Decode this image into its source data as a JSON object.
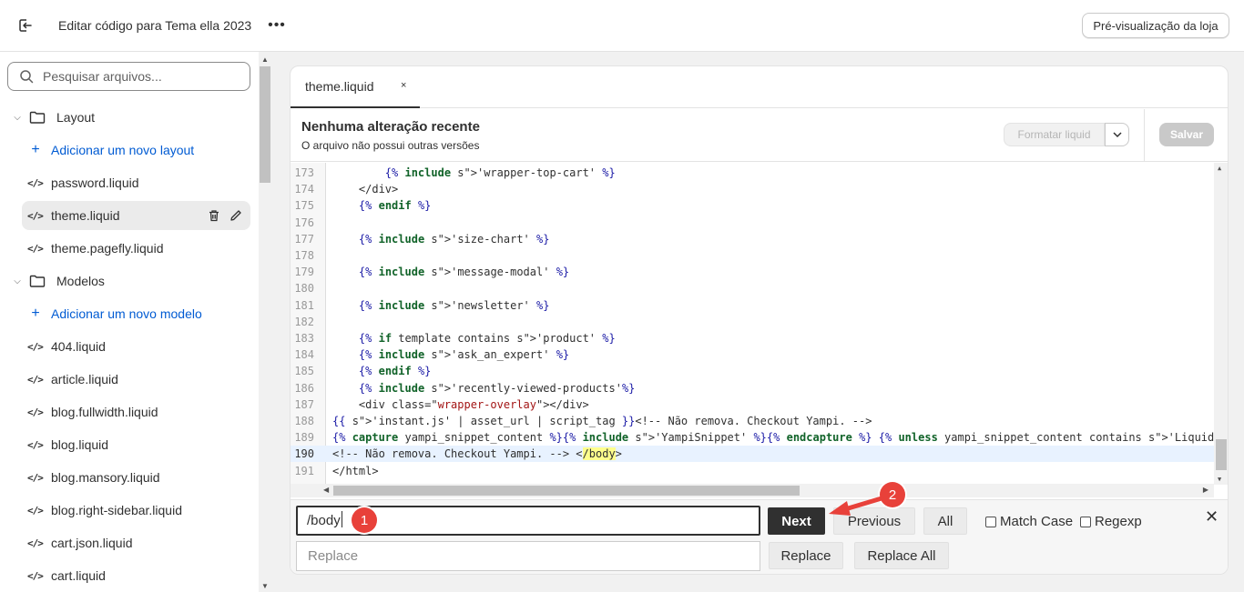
{
  "topbar": {
    "title": "Editar código para Tema ella 2023",
    "preview_label": "Pré-visualização da loja",
    "more_label": "•••"
  },
  "sidebar": {
    "search_placeholder": "Pesquisar arquivos...",
    "folders": [
      {
        "label": "Layout",
        "add_label": "Adicionar um novo layout"
      },
      {
        "label": "Modelos",
        "add_label": "Adicionar um novo modelo"
      }
    ],
    "layout_files": [
      "password.liquid",
      "theme.liquid",
      "theme.pagefly.liquid"
    ],
    "template_files": [
      "404.liquid",
      "article.liquid",
      "blog.fullwidth.liquid",
      "blog.liquid",
      "blog.mansory.liquid",
      "blog.right-sidebar.liquid",
      "cart.json.liquid",
      "cart.liquid"
    ],
    "active_file": "theme.liquid"
  },
  "editor": {
    "tab_label": "theme.liquid",
    "tab_close": "×",
    "status_title": "Nenhuma alteração recente",
    "status_subtitle": "O arquivo não possui outras versões",
    "format_label": "Formatar liquid",
    "save_label": "Salvar",
    "active_line": 190,
    "lines": [
      {
        "n": "173",
        "t": "        {% include 'wrapper-top-cart' %}"
      },
      {
        "n": "174",
        "t": "    </div>"
      },
      {
        "n": "175",
        "t": "    {% endif %}"
      },
      {
        "n": "176",
        "t": ""
      },
      {
        "n": "177",
        "t": "    {% include 'size-chart' %}"
      },
      {
        "n": "178",
        "t": ""
      },
      {
        "n": "179",
        "t": "    {% include 'message-modal' %}"
      },
      {
        "n": "180",
        "t": ""
      },
      {
        "n": "181",
        "t": "    {% include 'newsletter' %}"
      },
      {
        "n": "182",
        "t": ""
      },
      {
        "n": "183",
        "t": "    {% if template contains 'product' %}"
      },
      {
        "n": "184",
        "t": "    {% include 'ask_an_expert' %}"
      },
      {
        "n": "185",
        "t": "    {% endif %}"
      },
      {
        "n": "186",
        "t": "    {% include 'recently-viewed-products'%}"
      },
      {
        "n": "187",
        "t": "    <div class=\"wrapper-overlay\"></div>"
      },
      {
        "n": "188",
        "t": "{{ 'instant.js' | asset_url | script_tag }}<!-- Não remova. Checkout Yampi. -->"
      },
      {
        "n": "189",
        "t": "{% capture yampi_snippet_content %}{% include 'YampiSnippet' %}{% endcapture %} {% unless yampi_snippet_content contains 'Liquid error'"
      },
      {
        "n": "190",
        "t": "<!-- Não remova. Checkout Yampi. --> </body>"
      },
      {
        "n": "191",
        "t": "</html>"
      }
    ]
  },
  "find": {
    "query": "/body",
    "replace_placeholder": "Replace",
    "next_label": "Next",
    "previous_label": "Previous",
    "all_label": "All",
    "match_case_label": "Match Case",
    "regexp_label": "Regexp",
    "replace_label": "Replace",
    "replace_all_label": "Replace All",
    "close_label": "✕"
  },
  "annotations": {
    "badge1": "1",
    "badge2": "2",
    "badge_color": "#e8413a"
  },
  "colors": {
    "accent_link": "#005bd3",
    "primary_button": "#303030",
    "highlight": "#ffff8c"
  }
}
